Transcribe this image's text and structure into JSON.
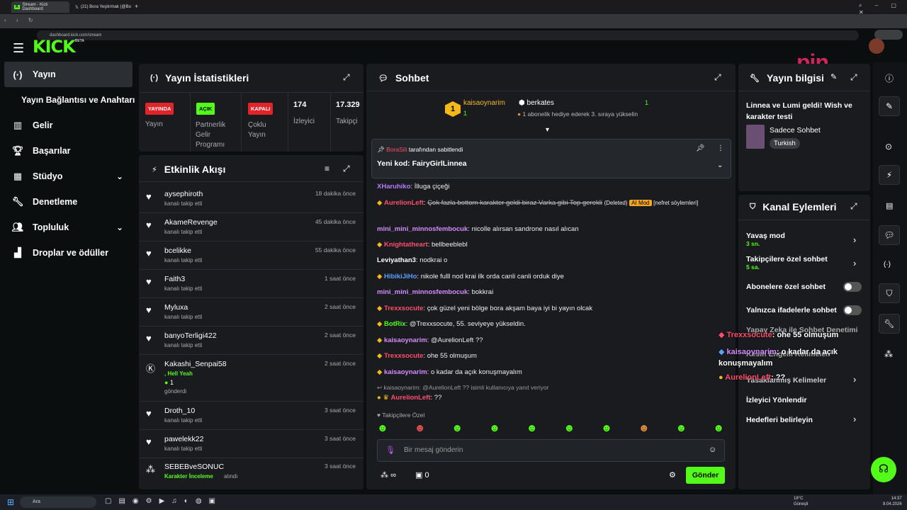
{
  "browser": {
    "tabs": [
      "Stream - Kick Dashboard",
      "(21) Bora Yeşilırmak (@Bo"
    ],
    "url": "dashboard.kick.com/stream"
  },
  "logo": {
    "text": "KICK",
    "beta": "BETA"
  },
  "sidebar": {
    "items": [
      {
        "label": "Yayın",
        "icon": "broadcast-icon"
      },
      {
        "label": "Yayın Bağlantısı ve Anahtarı",
        "icon": ""
      },
      {
        "label": "Gelir",
        "icon": "chart-icon"
      },
      {
        "label": "Başarılar",
        "icon": "trophy-icon"
      },
      {
        "label": "Stüdyo",
        "icon": "grid-icon"
      },
      {
        "label": "Denetleme",
        "icon": "wrench-icon"
      },
      {
        "label": "Topluluk",
        "icon": "people-icon"
      },
      {
        "label": "Droplar ve ödüller",
        "icon": "gift-icon"
      }
    ]
  },
  "stats": {
    "title": "Yayın İstatistikleri",
    "badges": [
      "YAYINDA",
      "AÇIK",
      "KAPALI"
    ],
    "labels": [
      "Yayın",
      "Partnerlik Gelir Programı",
      "Çoklu Yayın",
      "İzleyici",
      "Takipçi"
    ],
    "viewers": "174",
    "followers": "17.329"
  },
  "feed": {
    "title": "Etkinlik Akışı",
    "items": [
      {
        "user": "aysephiroth",
        "sub": "kanalı takip etti",
        "time": "18 dakika önce"
      },
      {
        "user": "AkameRevenge",
        "sub": "kanalı takip etti",
        "time": "45 dakika önce"
      },
      {
        "user": "bcelikke",
        "sub": "kanalı takip etti",
        "time": "55 dakika önce"
      },
      {
        "user": "Faith3",
        "sub": "kanalı takip etti",
        "time": "1 saat önce"
      },
      {
        "user": "Myluxa",
        "sub": "kanalı takip etti",
        "time": "2 saat önce"
      },
      {
        "user": "banyoTerligi422",
        "sub": "kanalı takip etti",
        "time": "2 saat önce"
      },
      {
        "user": "Kakashi_Senpai58",
        "sub": ", Hell Yeah",
        "extra": "1",
        "extra2": "gönderdi",
        "time": "2 saat önce"
      },
      {
        "user": "Droth_10",
        "sub": "kanalı takip etti",
        "time": "3 saat önce"
      },
      {
        "user": "pawelekk22",
        "sub": "kanalı takip etti",
        "time": "3 saat önce"
      },
      {
        "user": "SEBEBveSONUC",
        "sub": "Karakter İnceleme",
        "sub2": "alındı",
        "time": "3 saat önce"
      }
    ]
  },
  "chat": {
    "title": "Sohbet",
    "gift_user": "kaisaoynarim",
    "gift_count": "1",
    "gift_target": "berkates",
    "gift_target_count": "1",
    "gift_text": "1 abonelik hediye ederek 3. sıraya yükselin",
    "pin_by": "BoraSili",
    "pin_label": "tarafından sabitlendi",
    "pin_text": "Yeni kod: FairyGirlLinnea",
    "messages": [
      {
        "user": "XHaruhiko",
        "text": "İlluga çiçeği",
        "color": "#b57cff"
      },
      {
        "user": "AurelionLeft",
        "text": "Çok fazla bottom karakter geldi biraz Varka gibi Top gerekli",
        "deleted": "(Deleted)",
        "mod": "AI Mod",
        "tail": "[nefret söylemleri]",
        "color": "#ff4d6d"
      },
      {
        "user": "mini_mini_minnosfembocuk",
        "text": "nicolle alırsan sandrone nasıl alıcan",
        "color": "#d58cff"
      },
      {
        "user": "Knightatheart",
        "text": "bellbeeblebl",
        "color": "#ff4d6d"
      },
      {
        "user": "Leviyathan3",
        "text": "nodkrai o",
        "color": "#ffffff"
      },
      {
        "user": "HibikiJiHo",
        "text": "nikole fulll nod krai ilk orda canli canli orduk diye",
        "color": "#5aa0ff"
      },
      {
        "user": "mini_mini_minnosfembocuk",
        "text": "bokkrai",
        "color": "#d58cff"
      },
      {
        "user": "Trexxsocute",
        "text": "çok güzel yeni bölge bora akşam baya iyi bi yayın olcak",
        "color": "#ff4d6d"
      },
      {
        "user": "BotRix",
        "text": "@Trexxsocute, 55. seviyeye yükseldin.",
        "color": "#53fc18"
      },
      {
        "user": "kaisaoynarim",
        "text": "@AurelionLeft ??",
        "color": "#d58cff"
      },
      {
        "user": "Trexxsocute",
        "text": "ohe 55 olmuşum",
        "color": "#ff4d6d"
      },
      {
        "user": "kaisaoynarim",
        "text": "o kadar da açık konuşmayalım",
        "color": "#d58cff"
      }
    ],
    "reply_hint": "kaisaoynarim: @AurelionLeft ?? isimli kullanıcıya yanıt veriyor",
    "reply_user": "AurelionLeft",
    "reply_text": "??",
    "followers_only": "Takipçilere Özel",
    "input_placeholder": "Bir mesaj gönderin",
    "send": "Gönder",
    "points": "∞",
    "count": "0"
  },
  "info": {
    "title": "Yayın bilgisi",
    "desc": "Linnea ve Lumi geldi! Wish ve karakter testi",
    "category": "Sadece Sohbet",
    "lang": "Turkish"
  },
  "actions": {
    "title": "Kanal Eylemleri",
    "items": [
      {
        "label": "Yavaş mod",
        "val": "3 sn."
      },
      {
        "label": "Takipçilere özel sohbet",
        "val": "5 sa."
      },
      {
        "label": "Abonelere özel sohbet"
      },
      {
        "label": "Yalnızca ifadelerle sohbet"
      },
      {
        "label": "Yapay Zeka ile Sohbet Denetimi"
      },
      {
        "label": "Kesin Engelli Kelimeler"
      },
      {
        "label": "Yasaklanmış Kelimeler"
      },
      {
        "label": "İzleyici Yönlendir"
      },
      {
        "label": "Hedefleri belirleyin"
      }
    ]
  },
  "overlay": {
    "l1_user": "Trexxsocute",
    "l1_text": ": ohe 55 olmuşum",
    "l2_user": "kaisaoynarim",
    "l2_text": ": o kadar da açık konuşmayalım",
    "l3_user": "AurelionLeft",
    "l3_text": ": ??"
  },
  "taskbar": {
    "search": "Ara",
    "weather": "18°C",
    "weather2": "Güneşli",
    "time": "14:37",
    "date": "8.04.2026"
  },
  "colors": {
    "accent": "#53fc18",
    "panel": "#191b1f",
    "bg": "#0b0e0f"
  }
}
